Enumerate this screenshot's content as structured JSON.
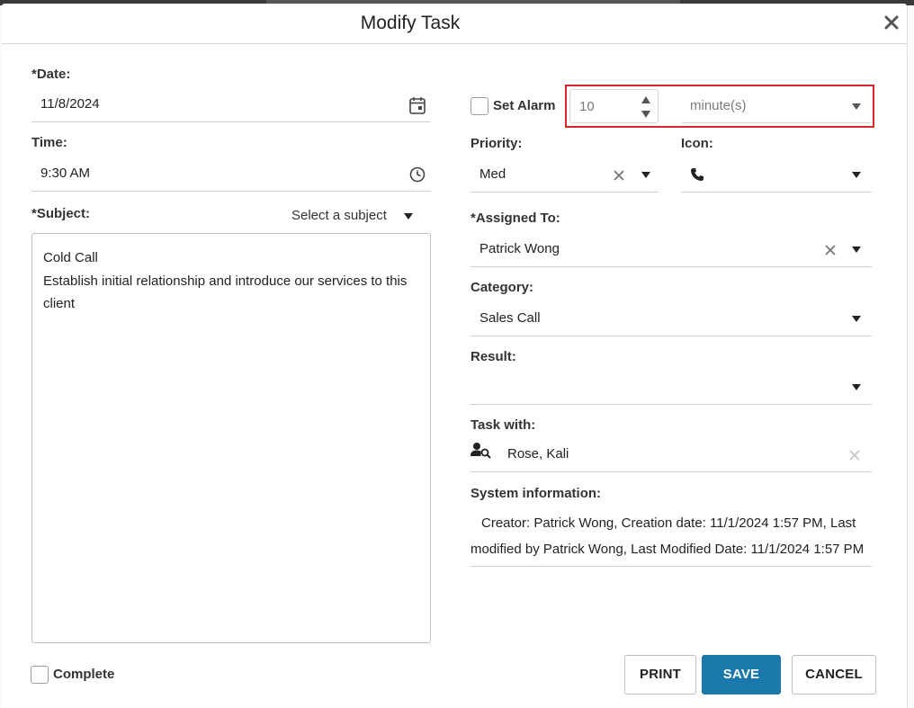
{
  "dialog": {
    "title": "Modify Task"
  },
  "left": {
    "date_label": "*Date:",
    "date_value": "11/8/2024",
    "time_label": "Time:",
    "time_value": "9:30 AM",
    "subject_label": "*Subject:",
    "subject_select": "Select a subject",
    "notes_line1": "Cold Call",
    "notes_line2": "Establish initial relationship and introduce our services to this client",
    "complete_label": "Complete"
  },
  "right": {
    "set_alarm_label": "Set Alarm",
    "alarm_value": "10",
    "alarm_unit": "minute(s)",
    "priority_label": "Priority:",
    "priority_value": "Med",
    "icon_label": "Icon:",
    "assigned_label": "*Assigned To:",
    "assigned_value": "Patrick Wong",
    "category_label": "Category:",
    "category_value": "Sales Call",
    "result_label": "Result:",
    "result_value": "",
    "task_with_label": "Task with:",
    "task_with_value": "Rose, Kali",
    "system_label": "System information:",
    "system_text": "Creator: Patrick Wong, Creation date: 11/1/2024 1:57 PM, Last modified by Patrick Wong, Last Modified Date: 11/1/2024 1:57 PM"
  },
  "buttons": {
    "print": "PRINT",
    "save": "SAVE",
    "cancel": "CANCEL"
  },
  "colors": {
    "primary": "#1a78ab",
    "highlight": "#d9252e"
  },
  "icons": {
    "close": "close-icon",
    "calendar": "calendar-icon",
    "clock": "clock-icon",
    "phone": "phone-icon",
    "contact_search": "contact-search-icon"
  }
}
